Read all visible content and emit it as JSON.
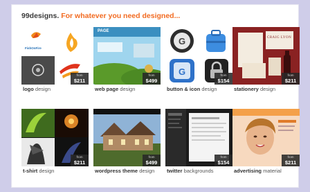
{
  "header": {
    "brand": "99designs.",
    "tagline": "For whatever you need designed..."
  },
  "price_prefix": "from",
  "categories": [
    {
      "bold": "logo",
      "rest": " design",
      "price": "$211"
    },
    {
      "bold": "web page",
      "rest": " design",
      "price": "$499"
    },
    {
      "bold": "button & icon",
      "rest": " design",
      "price": "$154"
    },
    {
      "bold": "stationery",
      "rest": " design",
      "price": "$211"
    },
    {
      "bold": "t-shirt",
      "rest": " design",
      "price": "$211"
    },
    {
      "bold": "wordpress theme",
      "rest": " design",
      "price": "$499"
    },
    {
      "bold": "twitter",
      "rest": " backgrounds",
      "price": "$154"
    },
    {
      "bold": "advertising",
      "rest": " material",
      "price": "$211"
    }
  ],
  "thumb_text": {
    "logo_brand": "FishOnFire",
    "stationery_brand": "CRAIG LYON",
    "web_page_header": "PAGE"
  },
  "colors": {
    "background": "#cfcde9",
    "accent": "#f26b21",
    "price_badge": "#282828"
  }
}
